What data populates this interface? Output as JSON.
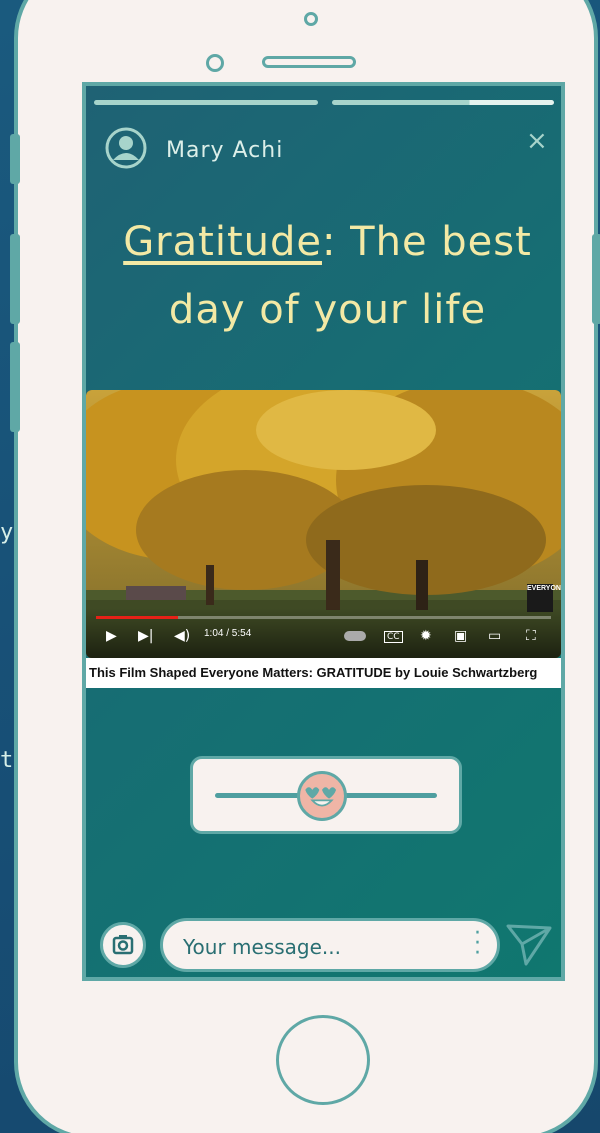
{
  "background": {
    "fragments": [
      "y",
      "t"
    ]
  },
  "story": {
    "user_name": "Mary Achi",
    "close_label": "×",
    "title_highlight": "Gratitude",
    "title_rest_line1": ": The best",
    "title_line2": "day of your life"
  },
  "video": {
    "time": "1:04 / 5:54",
    "progress": 0.18,
    "channel_logo": "EVERYONE",
    "caption": "This Film Shaped Everyone Matters: GRATITUDE by Louie Schwartzberg"
  },
  "reaction_slider": {
    "emoji": "heart-eyes-emoji",
    "value": 0.48
  },
  "composer": {
    "placeholder": "Your message..."
  },
  "colors": {
    "accent": "#5fa8a6",
    "title": "#f3e9a5",
    "phone_body": "#f8f2ef"
  }
}
